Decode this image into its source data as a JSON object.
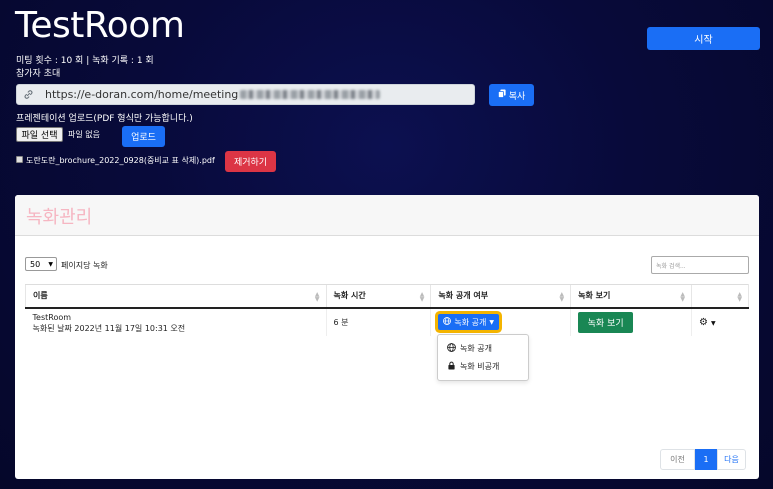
{
  "header": {
    "title": "TestRoom",
    "start_label": "시작",
    "stats": "미팅 횟수 : 10 회 | 녹화 기록 : 1 회",
    "invite_label": "참가자 초대"
  },
  "invite": {
    "url": "https://e-doran.com/home/meeting",
    "copy_label": "복사"
  },
  "presentation": {
    "label": "프레젠테이션 업로드(PDF 형식만 가능합니다.)",
    "choose_file_label": "파일 선택",
    "no_file_label": "파일 없음",
    "upload_label": "업로드",
    "file_name": "도란도란_brochure_2022_0928(중비교 표 삭제).pdf",
    "remove_label": "제거하기"
  },
  "recordings": {
    "title": "녹화관리",
    "page_size": "50",
    "per_page_label": "페이지당 녹화",
    "search_placeholder": "녹화 검색...",
    "columns": [
      "이름",
      "녹화 시간",
      "녹화 공개 여부",
      "녹화 보기",
      ""
    ],
    "rows": [
      {
        "name": "TestRoom",
        "recorded_at": "녹화된 날짜 2022년 11월 17일 10:31 오전",
        "duration": "6 분",
        "visibility_label": "녹화 공개",
        "view_label": "녹화 보기"
      }
    ],
    "visibility_menu": [
      "녹화 공개",
      "녹화 비공개"
    ],
    "pagination": {
      "prev": "이전",
      "current": "1",
      "next": "다음"
    }
  },
  "colors": {
    "primary": "#1a6ef5",
    "danger": "#dc3545",
    "success": "#198754",
    "highlight": "#f4b400",
    "title_pink": "#f6b6c2"
  }
}
